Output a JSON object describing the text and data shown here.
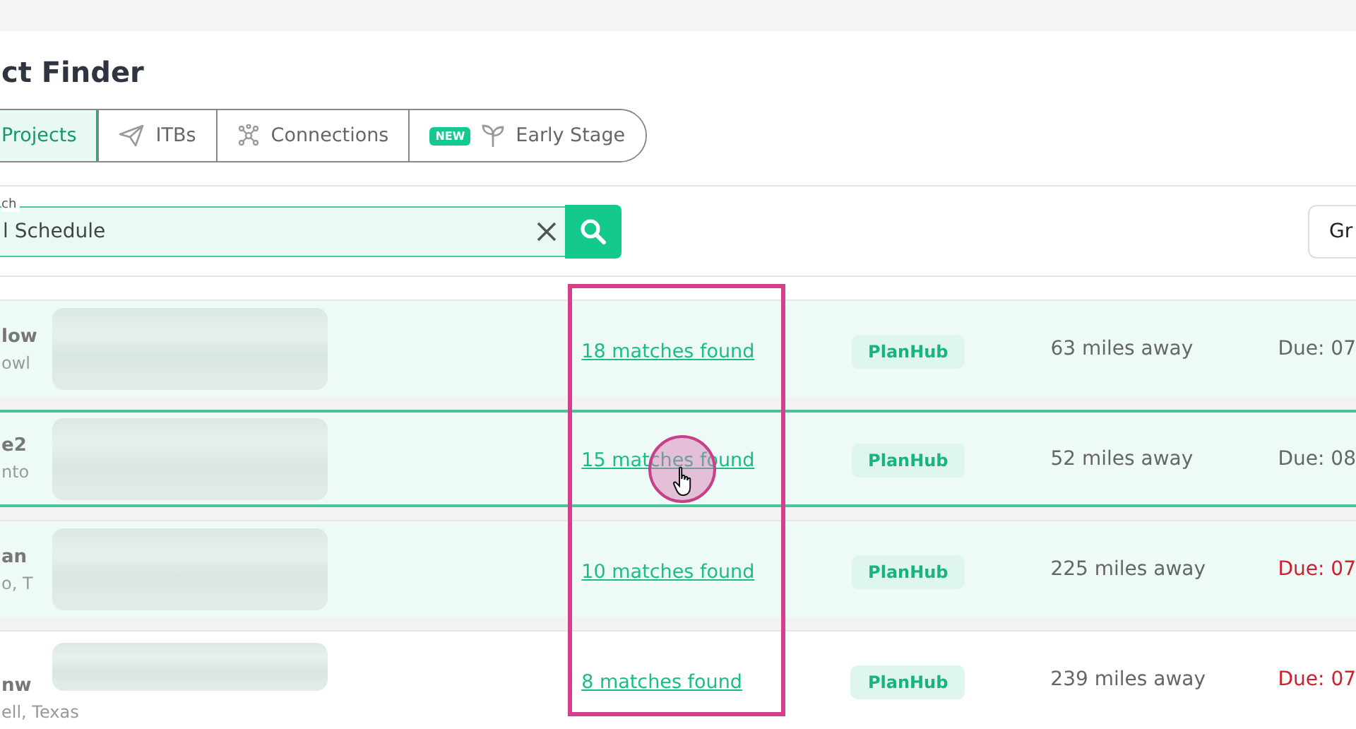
{
  "page": {
    "title": "ct Finder"
  },
  "tabs": [
    {
      "label": "Projects",
      "selected": true
    },
    {
      "label": "ITBs",
      "selected": false
    },
    {
      "label": "Connections",
      "selected": false
    },
    {
      "label": "Early Stage",
      "selected": false,
      "badge": "NEW"
    }
  ],
  "search": {
    "label": "ch",
    "value": "l Schedule"
  },
  "toolbar_button": "Gr",
  "rows": [
    {
      "name": "low",
      "location": "owl",
      "matches": "18 matches found",
      "source": "PlanHub",
      "distance": "63 miles away",
      "due": "Due: 07",
      "overdue": false,
      "highlighted": true,
      "selected": false
    },
    {
      "name": "e2",
      "location": "nto",
      "matches": "15 matches found",
      "source": "PlanHub",
      "distance": "52 miles away",
      "due": "Due: 08",
      "overdue": false,
      "highlighted": true,
      "selected": true
    },
    {
      "name": "an",
      "location": "o, T",
      "matches": "10 matches found",
      "source": "PlanHub",
      "distance": "225 miles away",
      "due": "Due: 07",
      "overdue": true,
      "highlighted": true,
      "selected": false
    },
    {
      "name": "nw",
      "location": "ell, Texas",
      "matches": "8 matches found",
      "source": "PlanHub",
      "distance": "239 miles away",
      "due": "Due: 07",
      "overdue": true,
      "highlighted": false,
      "selected": false
    }
  ]
}
